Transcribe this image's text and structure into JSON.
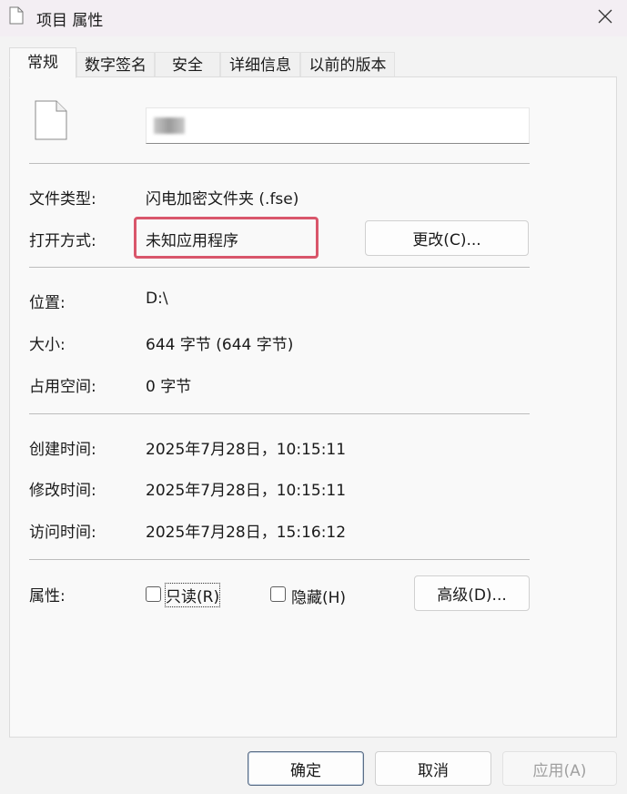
{
  "window": {
    "title": "项目 属性",
    "close_icon": "close-icon"
  },
  "tabs": [
    {
      "label": "常规",
      "active": true
    },
    {
      "label": "数字签名",
      "active": false
    },
    {
      "label": "安全",
      "active": false
    },
    {
      "label": "详细信息",
      "active": false
    },
    {
      "label": "以前的版本",
      "active": false
    }
  ],
  "file": {
    "icon": "document-icon"
  },
  "general": {
    "file_type_label": "文件类型:",
    "file_type_value": "闪电加密文件夹 (.fse)",
    "open_with_label": "打开方式:",
    "open_with_value": "未知应用程序",
    "change_button": "更改(C)...",
    "location_label": "位置:",
    "location_value": "D:\\",
    "size_label": "大小:",
    "size_value": "644 字节 (644 字节)",
    "disk_size_label": "占用空间:",
    "disk_size_value": "0 字节",
    "created_label": "创建时间:",
    "created_value": "2025年7月28日，10:15:11",
    "modified_label": "修改时间:",
    "modified_value": "2025年7月28日，10:15:11",
    "accessed_label": "访问时间:",
    "accessed_value": "2025年7月28日，15:16:12",
    "attributes_label": "属性:",
    "readonly_label": "只读(R)",
    "readonly_checked": false,
    "hidden_label": "隐藏(H)",
    "hidden_checked": false,
    "advanced_button": "高级(D)..."
  },
  "footer": {
    "ok_button": "确定",
    "cancel_button": "取消",
    "apply_button": "应用(A)"
  },
  "colors": {
    "highlight": "#d9566b",
    "primary_border": "#5b6e86"
  }
}
